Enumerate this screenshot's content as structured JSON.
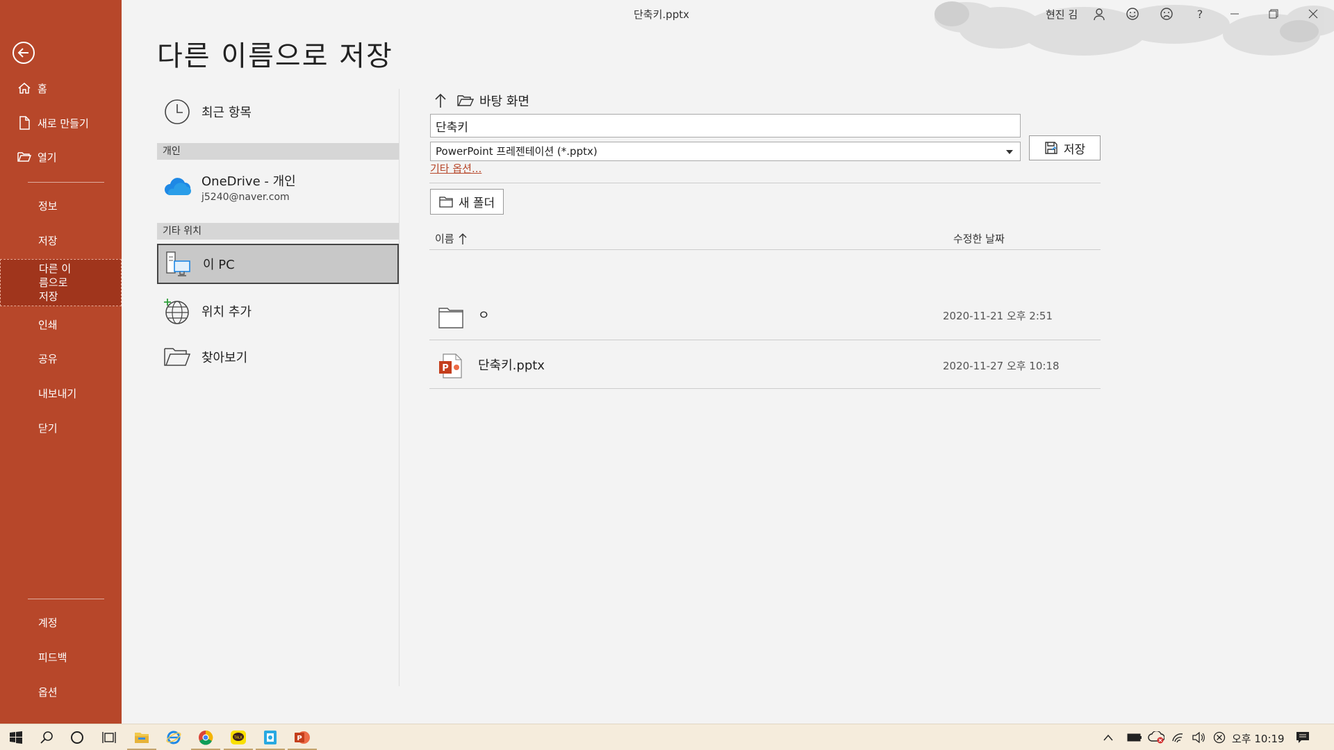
{
  "window": {
    "title": "단축키.pptx",
    "user": "현진 김"
  },
  "nav": {
    "items": [
      {
        "label": "홈"
      },
      {
        "label": "새로 만들기"
      },
      {
        "label": "열기"
      },
      {
        "label": "정보"
      },
      {
        "label": "저장"
      },
      {
        "label": "다른 이름으로 저장"
      },
      {
        "label": "인쇄"
      },
      {
        "label": "공유"
      },
      {
        "label": "내보내기"
      },
      {
        "label": "닫기"
      },
      {
        "label": "계정"
      },
      {
        "label": "피드백"
      },
      {
        "label": "옵션"
      }
    ],
    "active_label": "다른 이름으로 저장",
    "accent_color": "#b7472a"
  },
  "page": {
    "title": "다른 이름으로 저장"
  },
  "locations": {
    "recent": "최근 항목",
    "personal_header": "개인",
    "onedrive_title": "OneDrive - 개인",
    "onedrive_email": "j5240@naver.com",
    "other_header": "기타 위치",
    "this_pc": "이 PC",
    "add_place": "위치 추가",
    "browse": "찾아보기"
  },
  "save": {
    "current_folder": "바탕 화면",
    "filename_value": "단축키",
    "filetype_value": "PowerPoint 프레젠테이션 (*.pptx)",
    "more_options": "기타 옵션...",
    "save_label": "저장",
    "new_folder_label": "새 폴더"
  },
  "file_list": {
    "col_name": "이름",
    "col_date": "수정한 날짜",
    "rows": [
      {
        "name": "ㅇ",
        "date": "2020-11-21 오후 2:51",
        "type": "folder"
      },
      {
        "name": "단축키.pptx",
        "date": "2020-11-27 오후 10:18",
        "type": "pptx"
      }
    ]
  },
  "taskbar": {
    "clock": "오후 10:19"
  }
}
